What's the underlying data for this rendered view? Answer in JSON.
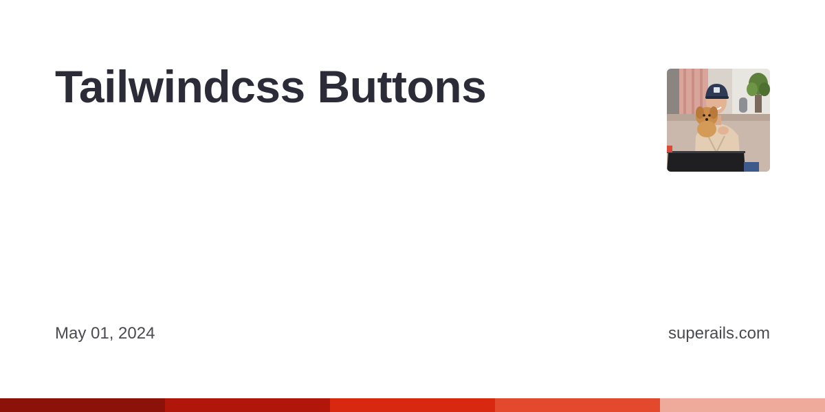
{
  "title": "Tailwindcss Buttons",
  "date": "May 01, 2024",
  "site": "superails.com",
  "avatar": {
    "icon": "author-photo"
  },
  "stripe": {
    "colors": [
      "#8c1109",
      "#b0170a",
      "#d8280f",
      "#e2492d",
      "#eeaa9a"
    ]
  }
}
